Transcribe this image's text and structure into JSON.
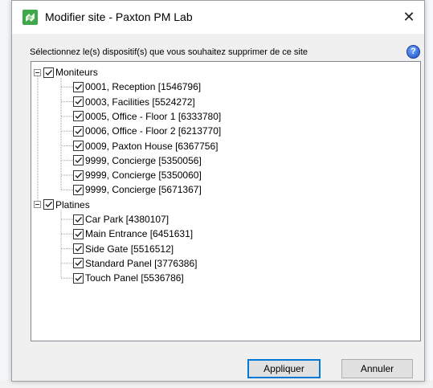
{
  "window": {
    "title": "Modifier site - Paxton PM Lab",
    "app_icon": "paxton-app-icon",
    "close_glyph": "✕"
  },
  "instruction": "Sélectionnez le(s) dispositif(s) que vous souhaitez supprimer de ce site",
  "help_glyph": "?",
  "tree": {
    "groups": [
      {
        "label": "Moniteurs",
        "checked": true,
        "expanded": true,
        "items": [
          {
            "label": "0001, Reception [1546796]",
            "checked": true
          },
          {
            "label": "0003, Facilities [5524272]",
            "checked": true
          },
          {
            "label": "0005, Office - Floor 1 [6333780]",
            "checked": true
          },
          {
            "label": "0006, Office - Floor 2 [6213770]",
            "checked": true
          },
          {
            "label": "0009, Paxton House [6367756]",
            "checked": true
          },
          {
            "label": "9999, Concierge [5350056]",
            "checked": true
          },
          {
            "label": "9999, Concierge [5350060]",
            "checked": true
          },
          {
            "label": "9999, Concierge [5671367]",
            "checked": true
          }
        ]
      },
      {
        "label": "Platines",
        "checked": true,
        "expanded": true,
        "items": [
          {
            "label": "Car Park [4380107]",
            "checked": true
          },
          {
            "label": "Main Entrance [6451631]",
            "checked": true
          },
          {
            "label": "Side Gate [5516512]",
            "checked": true
          },
          {
            "label": "Standard Panel [3776386]",
            "checked": true
          },
          {
            "label": "Touch Panel [5536786]",
            "checked": true
          }
        ]
      }
    ]
  },
  "buttons": {
    "apply_label": "Appliquer",
    "cancel_label": "Annuler"
  },
  "colors": {
    "accent_focus": "#0078d7",
    "app_icon_green": "#3ea84a"
  }
}
